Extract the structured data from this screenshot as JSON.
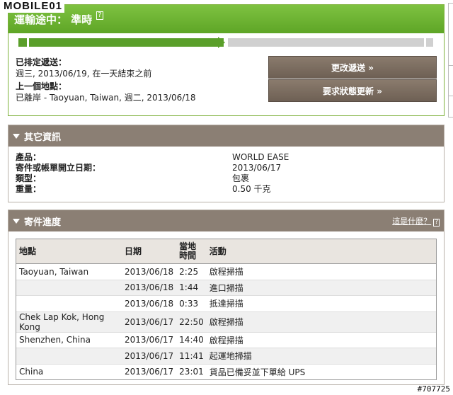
{
  "watermark": {
    "top": "MOBILE01",
    "bottom": "#707725"
  },
  "status": {
    "title": "運輸途中： 準時",
    "help_icon": "?",
    "progress_fraction": 0.5,
    "scheduled_label": "已排定遞送：",
    "scheduled_value": "週三, 2013/06/19, 在一天結束之前",
    "last_location_label": "上一個地點：",
    "last_location_value": "已離岸 - Taoyuan, Taiwan, 週二, 2013/06/18",
    "change_delivery_button": "更改遞送 »",
    "request_update_button": "要求狀態更新 »"
  },
  "other_info": {
    "title": "其它資訊",
    "rows": [
      {
        "label": "產品：",
        "value": "WORLD EASE"
      },
      {
        "label": "寄件或帳單開立日期：",
        "value": "2013/06/17"
      },
      {
        "label": "類型：",
        "value": "包裹"
      },
      {
        "label": "重量：",
        "value": "0.50 千克"
      }
    ]
  },
  "progress_panel": {
    "title": "寄件進度",
    "help_link": "這是什麼？",
    "columns": {
      "location": "地點",
      "date": "日期",
      "local_time_line1": "當地",
      "local_time_line2": "時間",
      "activity": "活動"
    },
    "rows": [
      {
        "location": "Taoyuan, Taiwan",
        "date": "2013/06/18",
        "time": "2:25",
        "activity": "啟程掃描"
      },
      {
        "location": "",
        "date": "2013/06/18",
        "time": "1:44",
        "activity": "進口掃描"
      },
      {
        "location": "",
        "date": "2013/06/18",
        "time": "0:33",
        "activity": "抵達掃描"
      },
      {
        "location": "Chek Lap Kok, Hong Kong",
        "date": "2013/06/17",
        "time": "22:50",
        "activity": "啟程掃描"
      },
      {
        "location": "Shenzhen, China",
        "date": "2013/06/17",
        "time": "14:40",
        "activity": "啟程掃描"
      },
      {
        "location": "",
        "date": "2013/06/17",
        "time": "11:41",
        "activity": "起運地掃描"
      },
      {
        "location": "China",
        "date": "2013/06/17",
        "time": "23:01",
        "activity": "貨品已備妥並下單給 UPS"
      }
    ]
  }
}
